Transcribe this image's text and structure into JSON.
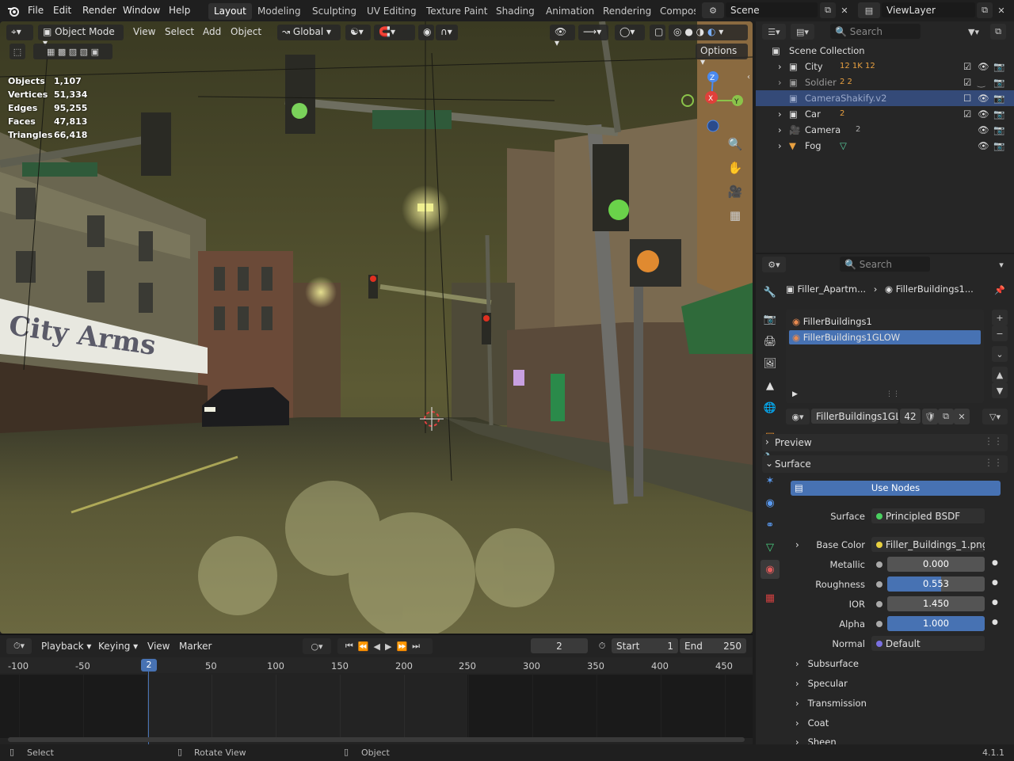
{
  "app": {
    "version": "4.1.1"
  },
  "menus": [
    "File",
    "Edit",
    "Render",
    "Window",
    "Help"
  ],
  "workspaces": [
    {
      "label": "Layout",
      "active": true
    },
    {
      "label": "Modeling"
    },
    {
      "label": "Sculpting"
    },
    {
      "label": "UV Editing"
    },
    {
      "label": "Texture Paint"
    },
    {
      "label": "Shading"
    },
    {
      "label": "Animation"
    },
    {
      "label": "Rendering"
    },
    {
      "label": "Compos"
    }
  ],
  "scene": {
    "name": "Scene",
    "view_layer": "ViewLayer"
  },
  "viewport": {
    "mode": "Object Mode",
    "menus": [
      "View",
      "Select",
      "Add",
      "Object"
    ],
    "orientation": "Global",
    "options_label": "Options",
    "stats": [
      {
        "label": "Objects",
        "value": "1,107"
      },
      {
        "label": "Vertices",
        "value": "51,334"
      },
      {
        "label": "Edges",
        "value": "95,255"
      },
      {
        "label": "Faces",
        "value": "47,813"
      },
      {
        "label": "Triangles",
        "value": "66,418"
      }
    ],
    "scene_texts": {
      "sign": "City Arms"
    },
    "gizmo": {
      "x": "X",
      "y": "Y",
      "z": "Z"
    }
  },
  "timeline": {
    "menus": [
      "Playback",
      "Keying",
      "View",
      "Marker"
    ],
    "current_frame": "2",
    "start_label": "Start",
    "start": "1",
    "end_label": "End",
    "end": "250",
    "ticks": [
      "-100",
      "-50",
      "50",
      "100",
      "150",
      "200",
      "250",
      "300",
      "350",
      "400",
      "450"
    ]
  },
  "outliner": {
    "search_placeholder": "Search",
    "root": "Scene Collection",
    "items": [
      {
        "name": "City",
        "badges": "12  1K  12",
        "selected": false
      },
      {
        "name": "Soldier",
        "badges": "2  2",
        "selected": false
      },
      {
        "name": "CameraShakify.v2",
        "badges": "",
        "selected": true
      },
      {
        "name": "Car",
        "badges": "2",
        "selected": false
      },
      {
        "name": "Camera",
        "badges": "2",
        "selected": false
      },
      {
        "name": "Fog",
        "badges": "",
        "selected": false
      }
    ]
  },
  "properties": {
    "search_placeholder": "Search",
    "breadcrumb_object": "Filler_Apartm...",
    "breadcrumb_material": "FillerBuildings1...",
    "material_slots": [
      "FillerBuildings1",
      "FillerBuildings1GLOW"
    ],
    "active_slot": 1,
    "material_name": "FillerBuildings1GL...",
    "user_count": "42",
    "sections": {
      "preview": "Preview",
      "surface": "Surface"
    },
    "use_nodes": "Use Nodes",
    "surface_label": "Surface",
    "surface_value": "Principled BSDF",
    "base_color_label": "Base Color",
    "base_color_value": "Filler_Buildings_1.png",
    "metallic_label": "Metallic",
    "metallic": "0.000",
    "roughness_label": "Roughness",
    "roughness": "0.553",
    "ior_label": "IOR",
    "ior": "1.450",
    "alpha_label": "Alpha",
    "alpha": "1.000",
    "normal_label": "Normal",
    "normal_value": "Default",
    "subpanels": [
      "Subsurface",
      "Specular",
      "Transmission",
      "Coat",
      "Sheen"
    ]
  },
  "status": {
    "select": "Select",
    "rotate": "Rotate View",
    "object": "Object"
  },
  "colors": {
    "accent": "#4772b3",
    "selection": "#344a78",
    "background": "#1d1d1d"
  }
}
